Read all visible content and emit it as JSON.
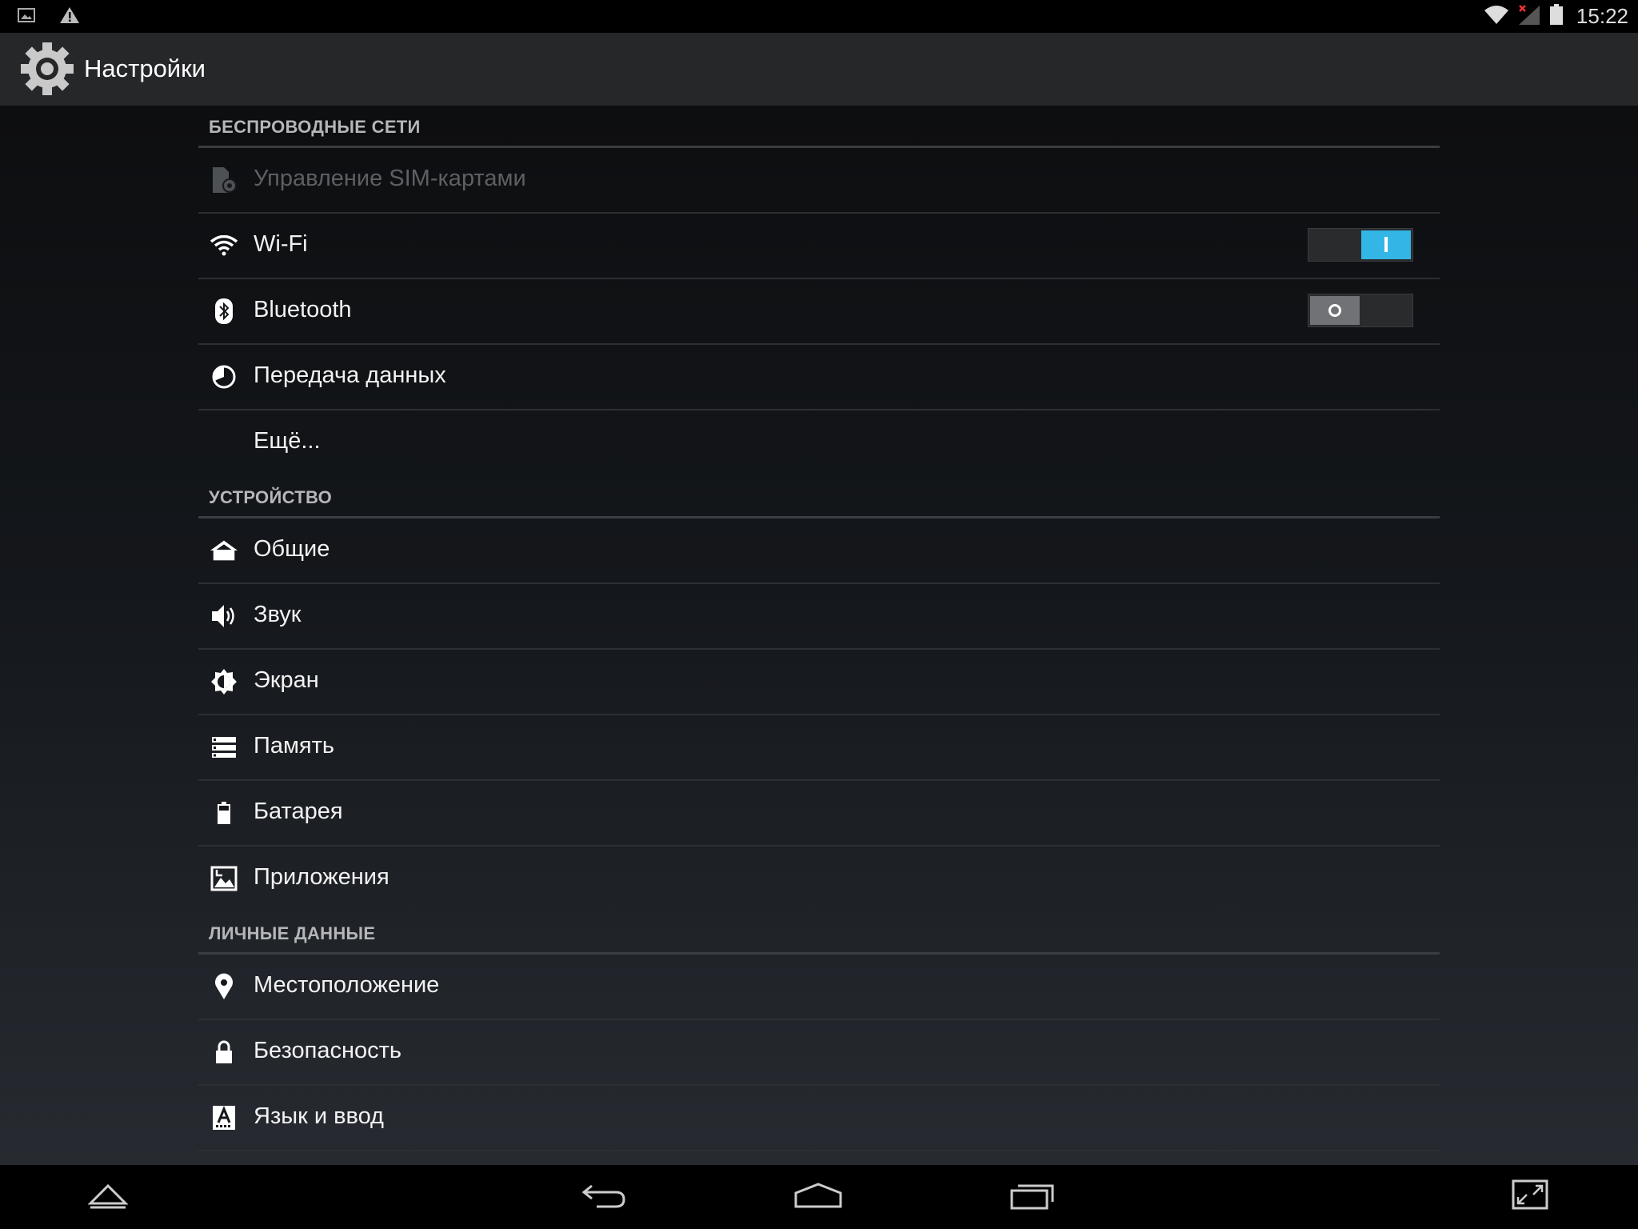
{
  "status_bar": {
    "time": "15:22",
    "left_icons": [
      "picture-icon",
      "warning-icon"
    ],
    "right_icons": [
      "wifi-icon",
      "signal-no-sim-icon",
      "battery-icon"
    ]
  },
  "action_bar": {
    "title": "Настройки",
    "icon": "settings-gear-icon"
  },
  "sections": [
    {
      "header": "БЕСПРОВОДНЫЕ СЕТИ",
      "items": [
        {
          "label": "Управление SIM-картами",
          "icon": "sim-card-icon",
          "disabled": true
        },
        {
          "label": "Wi-Fi",
          "icon": "wifi-icon",
          "toggle": "on",
          "toggle_text": "I"
        },
        {
          "label": "Bluetooth",
          "icon": "bluetooth-icon",
          "toggle": "off"
        },
        {
          "label": "Передача данных",
          "icon": "data-usage-icon"
        },
        {
          "label": "Ещё...",
          "icon": null
        }
      ]
    },
    {
      "header": "УСТРОЙСТВО",
      "items": [
        {
          "label": "Общие",
          "icon": "home-icon"
        },
        {
          "label": "Звук",
          "icon": "volume-icon"
        },
        {
          "label": "Экран",
          "icon": "brightness-icon"
        },
        {
          "label": "Память",
          "icon": "storage-icon"
        },
        {
          "label": "Батарея",
          "icon": "battery-icon"
        },
        {
          "label": "Приложения",
          "icon": "apps-icon"
        }
      ]
    },
    {
      "header": "ЛИЧНЫЕ ДАННЫЕ",
      "items": [
        {
          "label": "Местоположение",
          "icon": "location-icon"
        },
        {
          "label": "Безопасность",
          "icon": "lock-icon"
        },
        {
          "label": "Язык и ввод",
          "icon": "language-icon"
        }
      ]
    }
  ],
  "nav_bar": {
    "buttons": [
      "up-chevron-icon",
      "back-icon",
      "home-icon",
      "recent-apps-icon",
      "fullscreen-icon"
    ]
  },
  "colors": {
    "accent": "#33b5e5",
    "action_bar": "#262729",
    "toggle_off": "#707275"
  }
}
